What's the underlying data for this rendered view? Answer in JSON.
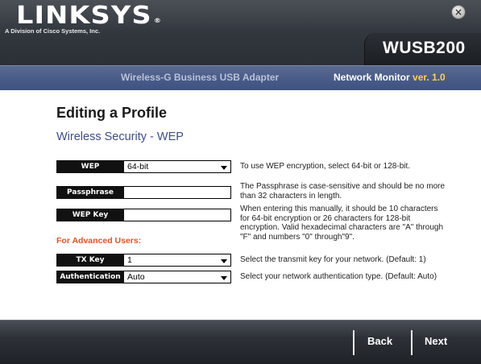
{
  "window": {
    "logo_text": "LINKSYS",
    "logo_reg": "®",
    "logo_subtitle": "A Division of Cisco Systems, Inc.",
    "close_glyph": "×",
    "model": "WUSB200",
    "product_name": "Wireless-G Business USB Adapter",
    "monitor_label": "Network Monitor",
    "monitor_version": "ver. 1.0"
  },
  "page": {
    "title": "Editing a Profile",
    "subtitle": "Wireless Security - WEP"
  },
  "form": {
    "wep": {
      "label": "WEP",
      "value": "64-bit",
      "help": "To use WEP encryption, select 64-bit or 128-bit."
    },
    "passphrase": {
      "label": "Passphrase",
      "value": "",
      "help": [
        "The Passphrase is case-sensitive and should be no more",
        "than 32 characters in length."
      ]
    },
    "wep_key": {
      "label": "WEP Key",
      "value": "",
      "help": [
        "When entering this manually, it should be 10 characters",
        "for 64-bit encryption or 26 characters for 128-bit",
        "encryption. Valid hexadecimal characters are \"A\" through",
        "\"F\" and numbers \"0\" through\"9\"."
      ]
    },
    "advanced_heading": "For Advanced Users:",
    "tx_key": {
      "label": "TX Key",
      "value": "1",
      "help": "Select the transmit key for your network. (Default: 1)"
    },
    "authentication": {
      "label": "Authentication",
      "value": "Auto",
      "help": "Select your network authentication type. (Default: Auto)"
    }
  },
  "footer": {
    "back_label": "Back",
    "next_label": "Next"
  },
  "colors": {
    "accent_blue": "#3d4d8a",
    "advanced_orange": "#e8501c",
    "version_yellow": "#ffd24a"
  },
  "icons": {
    "close": "close-icon",
    "dropdown": "chevron-down-icon"
  }
}
